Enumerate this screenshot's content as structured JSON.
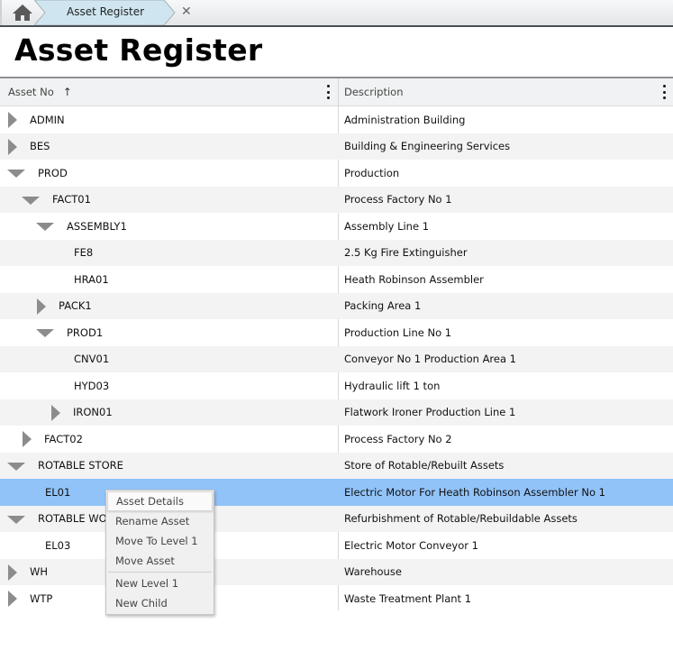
{
  "tabbar": {
    "home_icon": "home-icon",
    "breadcrumb": {
      "label": "Asset Register",
      "close_icon": "close-icon",
      "close_glyph": "✕"
    }
  },
  "page": {
    "title": "Asset Register"
  },
  "grid": {
    "columns": [
      {
        "label": "Asset No",
        "sort": "ascending",
        "sort_glyph": "↑",
        "menu_icon": "kebab-menu-icon"
      },
      {
        "label": "Description",
        "menu_icon": "kebab-menu-icon"
      }
    ],
    "rows": [
      {
        "asset": "ADMIN",
        "description": "Administration Building",
        "level": 0,
        "toggle": "collapsed"
      },
      {
        "asset": "BES",
        "description": "Building & Engineering Services",
        "level": 0,
        "toggle": "collapsed"
      },
      {
        "asset": "PROD",
        "description": "Production",
        "level": 0,
        "toggle": "expanded"
      },
      {
        "asset": "FACT01",
        "description": "Process Factory No 1",
        "level": 1,
        "toggle": "expanded"
      },
      {
        "asset": "ASSEMBLY1",
        "description": "Assembly Line 1",
        "level": 2,
        "toggle": "expanded"
      },
      {
        "asset": "FE8",
        "description": "2.5 Kg Fire Extinguisher",
        "level": 3,
        "toggle": "none"
      },
      {
        "asset": "HRA01",
        "description": "Heath Robinson Assembler",
        "level": 3,
        "toggle": "none"
      },
      {
        "asset": "PACK1",
        "description": "Packing Area 1",
        "level": 2,
        "toggle": "collapsed"
      },
      {
        "asset": "PROD1",
        "description": "Production Line No 1",
        "level": 2,
        "toggle": "expanded"
      },
      {
        "asset": "CNV01",
        "description": "Conveyor No 1 Production Area 1",
        "level": 3,
        "toggle": "none"
      },
      {
        "asset": "HYD03",
        "description": "Hydraulic lift 1 ton",
        "level": 3,
        "toggle": "none"
      },
      {
        "asset": "IRON01",
        "description": "Flatwork Ironer Production Line 1",
        "level": 3,
        "toggle": "collapsed"
      },
      {
        "asset": "FACT02",
        "description": "Process Factory No 2",
        "level": 1,
        "toggle": "collapsed"
      },
      {
        "asset": "ROTABLE STORE",
        "description": "Store of Rotable/Rebuilt Assets",
        "level": 0,
        "toggle": "expanded"
      },
      {
        "asset": "EL01",
        "description": "Electric Motor For Heath Robinson Assembler No 1",
        "level": 1,
        "toggle": "none",
        "selected": true
      },
      {
        "asset": "ROTABLE WORKSHOP",
        "description": "Refurbishment of Rotable/Rebuildable Assets",
        "level": 0,
        "toggle": "expanded"
      },
      {
        "asset": "EL03",
        "description": "Electric Motor Conveyor 1",
        "level": 1,
        "toggle": "none"
      },
      {
        "asset": "WH",
        "description": "Warehouse",
        "level": 0,
        "toggle": "collapsed"
      },
      {
        "asset": "WTP",
        "description": "Waste Treatment Plant 1",
        "level": 0,
        "toggle": "collapsed"
      }
    ]
  },
  "context_menu": {
    "items": [
      {
        "label": "Asset Details",
        "active": true
      },
      {
        "label": "Rename Asset"
      },
      {
        "label": "Move To Level 1"
      },
      {
        "label": "Move Asset"
      },
      {
        "separator": true
      },
      {
        "label": "New Level 1"
      },
      {
        "label": "New Child"
      }
    ]
  },
  "colors": {
    "selected_row": "#91c3f9",
    "alt_row": "#f3f3f3",
    "breadcrumb_bg": "#cfe6f0",
    "toggle_arrow": "#8c8c8c"
  }
}
